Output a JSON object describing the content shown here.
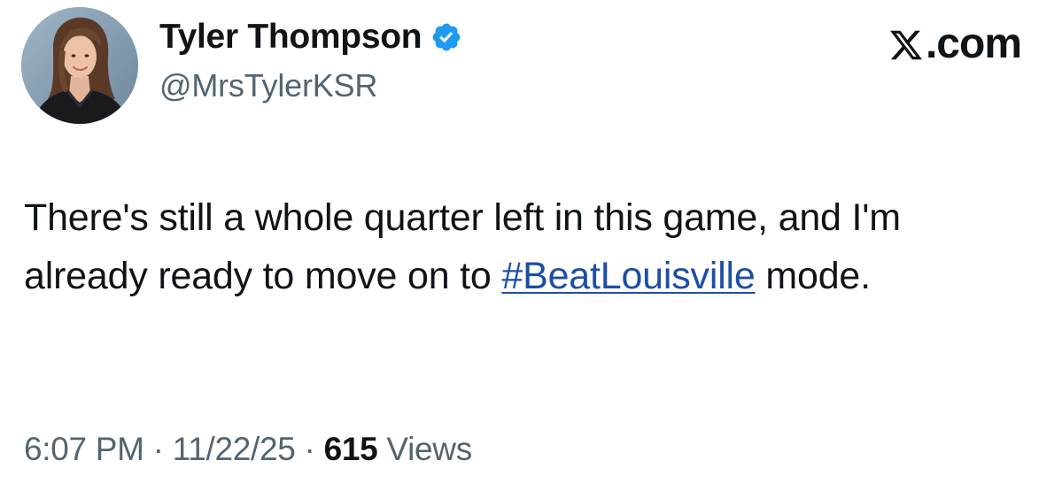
{
  "author": {
    "display_name": "Tyler Thompson",
    "handle": "@MrsTylerKSR",
    "verified_icon": "verified-badge-icon",
    "avatar": "profile-photo"
  },
  "brand": {
    "label": ".com",
    "icon": "x-logo-icon"
  },
  "tweet": {
    "text_before": "There's still a whole quarter left in this game, and I'm already ready to move on to ",
    "hashtag": "#BeatLouisville",
    "text_after": " mode."
  },
  "meta": {
    "time": "6:07 PM",
    "separator1": " · ",
    "date": "11/22/25",
    "separator2": " · ",
    "views_count": "615",
    "views_label": " Views"
  },
  "colors": {
    "text": "#0f1419",
    "secondary": "#536471",
    "hashtag": "#1d4ea5",
    "verified": "#1d9bf0"
  }
}
